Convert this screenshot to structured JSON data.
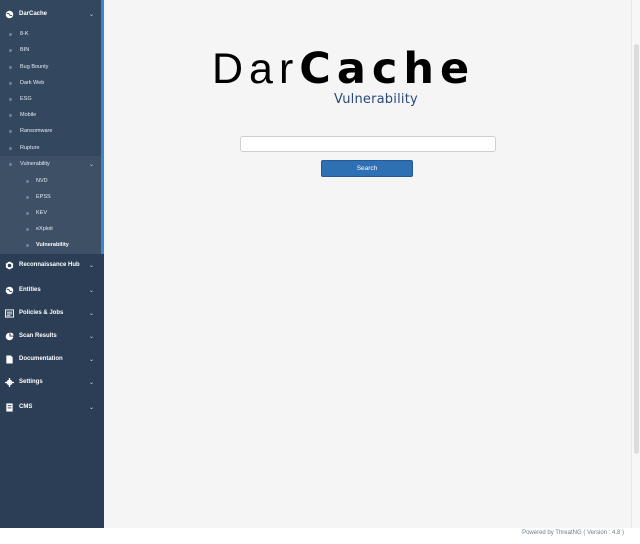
{
  "sidebar": {
    "top_item": {
      "label": "DarCache",
      "icon": "globe-icon"
    },
    "darcache_items": [
      "8-K",
      "BIN",
      "Bug Bounty",
      "Dark Web",
      "ESG",
      "Mobile",
      "Ransomware",
      "Rupture",
      "Vulnerability"
    ],
    "vulnerability_items": [
      "NVD",
      "EPSS",
      "KEV",
      "eXploit",
      "Vulnerability"
    ],
    "sections": [
      {
        "label": "Reconnaissance Hub",
        "icon": "radar-icon"
      },
      {
        "label": "Entities",
        "icon": "globe-icon"
      },
      {
        "label": "Policies & Jobs",
        "icon": "list-icon"
      },
      {
        "label": "Scan Results",
        "icon": "pie-chart-icon"
      },
      {
        "label": "Documentation",
        "icon": "document-icon"
      },
      {
        "label": "Settings",
        "icon": "gear-icon"
      },
      {
        "label": "CMS",
        "icon": "cms-icon"
      }
    ]
  },
  "main": {
    "logo": {
      "light": "Dar",
      "heavy": "Cache"
    },
    "subtitle": "Vulnerability",
    "search": {
      "placeholder": "",
      "button_label": "Search"
    }
  },
  "footer": {
    "text": "Powered by ThreatNG  ( Version : 4.8 )"
  },
  "colors": {
    "sidebar": "#2b3e55",
    "accent": "#3b86d1",
    "button": "#2f6fb3",
    "brand_subtitle": "#2a4a7a"
  }
}
